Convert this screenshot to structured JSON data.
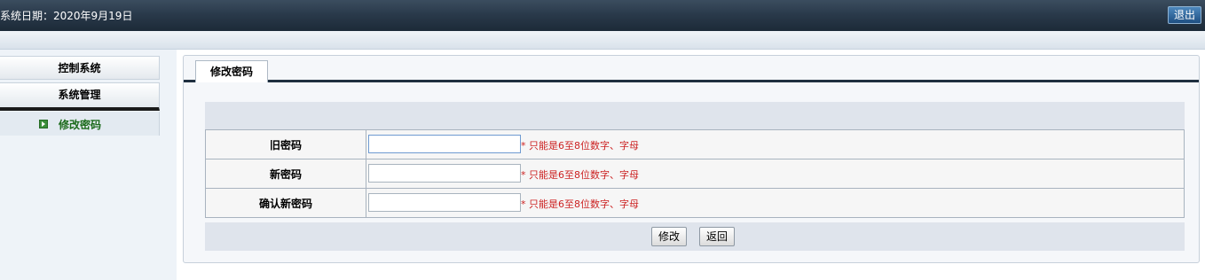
{
  "header": {
    "system_date": "系统日期：2020年9月19日",
    "logout_label": "退出"
  },
  "sidebar": {
    "items": [
      {
        "label": "控制系统"
      },
      {
        "label": "系统管理"
      },
      {
        "label": "修改密码",
        "icon": "arrow-right-icon",
        "active": true
      }
    ]
  },
  "main": {
    "tab_label": "修改密码",
    "fields": [
      {
        "label": "旧密码",
        "value": "",
        "hint": "* 只能是6至8位数字、字母"
      },
      {
        "label": "新密码",
        "value": "",
        "hint": "* 只能是6至8位数字、字母"
      },
      {
        "label": "确认新密码",
        "value": "",
        "hint": "* 只能是6至8位数字、字母"
      }
    ],
    "buttons": {
      "modify": "修改",
      "back": "返回"
    }
  },
  "colors": {
    "topbar": "#2a3a4b",
    "hint": "#cc2222",
    "active_nav": "#1c6b1c"
  }
}
